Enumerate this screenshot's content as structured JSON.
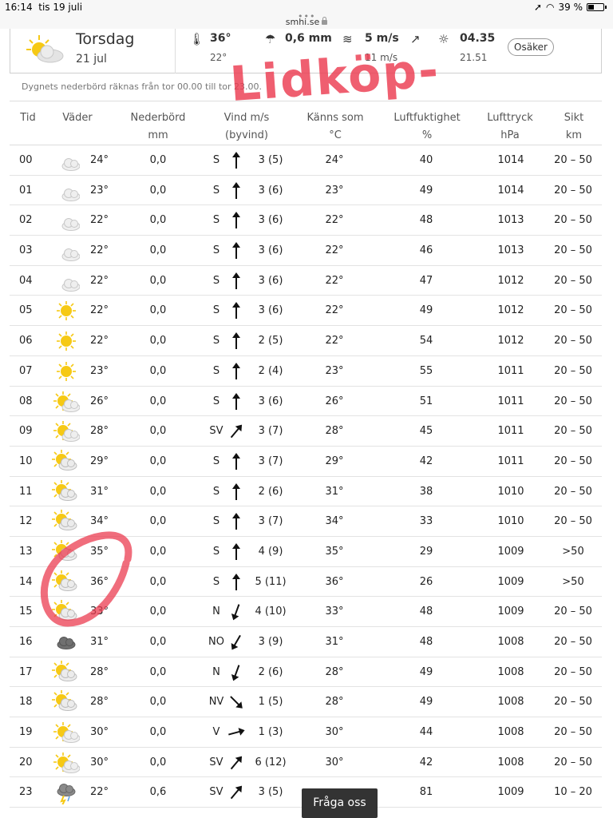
{
  "status": {
    "time": "16:14",
    "date": "tis 19 juli",
    "battery": "39 %"
  },
  "browser": {
    "url": "smhi.se"
  },
  "summary": {
    "day": "Torsdag",
    "date": "21 jul",
    "temp_max": "36°",
    "temp_min": "22°",
    "precip": "0,6 mm",
    "wind": "5 m/s",
    "gust": "11 m/s",
    "sunrise": "04.35",
    "sunset": "21.51",
    "uncertain_label": "Osäker"
  },
  "note": "Dygnets nederbörd räknas från tor 00.00 till tor 23.00.",
  "annotation": "Lidköp-",
  "colors": {
    "annotation": "#eb3c50",
    "sun": "#f6c915",
    "moon": "#f0c020",
    "cloud": "#dcdcdc",
    "dark_cloud": "#6e6e6e"
  },
  "table": {
    "headers": {
      "tid": "Tid",
      "vader": "Väder",
      "nederbord": "Nederbörd",
      "nederbord_unit": "mm",
      "vind": "Vind m/s",
      "vind_sub": "(byvind)",
      "kanns": "Känns som",
      "kanns_unit": "°C",
      "luft": "Luftfuktighet",
      "luft_unit": "%",
      "tryck": "Lufttryck",
      "tryck_unit": "hPa",
      "sikt": "Sikt",
      "sikt_unit": "km"
    },
    "rows": [
      {
        "tid": "00",
        "icon": "moon-cloud-icon",
        "temp": "24°",
        "rain": "0,0",
        "dir": "S",
        "wind": "3 (5)",
        "feel": "24°",
        "hum": "40",
        "press": "1014",
        "vis": "20 – 50"
      },
      {
        "tid": "01",
        "icon": "moon-cloud-icon",
        "temp": "23°",
        "rain": "0,0",
        "dir": "S",
        "wind": "3 (6)",
        "feel": "23°",
        "hum": "49",
        "press": "1014",
        "vis": "20 – 50"
      },
      {
        "tid": "02",
        "icon": "moon-cloud-icon",
        "temp": "22°",
        "rain": "0,0",
        "dir": "S",
        "wind": "3 (6)",
        "feel": "22°",
        "hum": "48",
        "press": "1013",
        "vis": "20 – 50"
      },
      {
        "tid": "03",
        "icon": "moon-cloud-icon",
        "temp": "22°",
        "rain": "0,0",
        "dir": "S",
        "wind": "3 (6)",
        "feel": "22°",
        "hum": "46",
        "press": "1013",
        "vis": "20 – 50"
      },
      {
        "tid": "04",
        "icon": "moon-cloud-icon",
        "temp": "22°",
        "rain": "0,0",
        "dir": "S",
        "wind": "3 (6)",
        "feel": "22°",
        "hum": "47",
        "press": "1012",
        "vis": "20 – 50"
      },
      {
        "tid": "05",
        "icon": "sun-icon",
        "temp": "22°",
        "rain": "0,0",
        "dir": "S",
        "wind": "3 (6)",
        "feel": "22°",
        "hum": "49",
        "press": "1012",
        "vis": "20 – 50"
      },
      {
        "tid": "06",
        "icon": "sun-icon",
        "temp": "22°",
        "rain": "0,0",
        "dir": "S",
        "wind": "2 (5)",
        "feel": "22°",
        "hum": "54",
        "press": "1012",
        "vis": "20 – 50"
      },
      {
        "tid": "07",
        "icon": "sun-icon",
        "temp": "23°",
        "rain": "0,0",
        "dir": "S",
        "wind": "2 (4)",
        "feel": "23°",
        "hum": "55",
        "press": "1011",
        "vis": "20 – 50"
      },
      {
        "tid": "08",
        "icon": "sun-cloud-icon",
        "temp": "26°",
        "rain": "0,0",
        "dir": "S",
        "wind": "3 (6)",
        "feel": "26°",
        "hum": "51",
        "press": "1011",
        "vis": "20 – 50"
      },
      {
        "tid": "09",
        "icon": "sun-cloud-icon",
        "temp": "28°",
        "rain": "0,0",
        "dir": "SV",
        "wind": "3 (7)",
        "feel": "28°",
        "hum": "45",
        "press": "1011",
        "vis": "20 – 50"
      },
      {
        "tid": "10",
        "icon": "cloud-sun-icon",
        "temp": "29°",
        "rain": "0,0",
        "dir": "S",
        "wind": "3 (7)",
        "feel": "29°",
        "hum": "42",
        "press": "1011",
        "vis": "20 – 50"
      },
      {
        "tid": "11",
        "icon": "cloud-sun-icon",
        "temp": "31°",
        "rain": "0,0",
        "dir": "S",
        "wind": "2 (6)",
        "feel": "31°",
        "hum": "38",
        "press": "1010",
        "vis": "20 – 50"
      },
      {
        "tid": "12",
        "icon": "cloud-sun-icon",
        "temp": "34°",
        "rain": "0,0",
        "dir": "S",
        "wind": "3 (7)",
        "feel": "34°",
        "hum": "33",
        "press": "1010",
        "vis": "20 – 50"
      },
      {
        "tid": "13",
        "icon": "cloud-sun-icon",
        "temp": "35°",
        "rain": "0,0",
        "dir": "S",
        "wind": "4 (9)",
        "feel": "35°",
        "hum": "29",
        "press": "1009",
        "vis": ">50"
      },
      {
        "tid": "14",
        "icon": "cloud-sun-icon",
        "temp": "36°",
        "rain": "0,0",
        "dir": "S",
        "wind": "5 (11)",
        "feel": "36°",
        "hum": "26",
        "press": "1009",
        "vis": ">50"
      },
      {
        "tid": "15",
        "icon": "cloud-sun-icon",
        "temp": "33°",
        "rain": "0,0",
        "dir": "N",
        "wind": "4 (10)",
        "feel": "33°",
        "hum": "48",
        "press": "1009",
        "vis": "20 – 50"
      },
      {
        "tid": "16",
        "icon": "dark-cloud-icon",
        "temp": "31°",
        "rain": "0,0",
        "dir": "NO",
        "wind": "3 (9)",
        "feel": "31°",
        "hum": "48",
        "press": "1008",
        "vis": "20 – 50"
      },
      {
        "tid": "17",
        "icon": "cloud-sun-icon",
        "temp": "28°",
        "rain": "0,0",
        "dir": "N",
        "wind": "2 (6)",
        "feel": "28°",
        "hum": "49",
        "press": "1008",
        "vis": "20 – 50"
      },
      {
        "tid": "18",
        "icon": "cloud-sun-icon",
        "temp": "28°",
        "rain": "0,0",
        "dir": "NV",
        "wind": "1 (5)",
        "feel": "28°",
        "hum": "49",
        "press": "1008",
        "vis": "20 – 50"
      },
      {
        "tid": "19",
        "icon": "sun-cloud-icon",
        "temp": "30°",
        "rain": "0,0",
        "dir": "V",
        "wind": "1 (3)",
        "feel": "30°",
        "hum": "44",
        "press": "1008",
        "vis": "20 – 50"
      },
      {
        "tid": "20",
        "icon": "sun-cloud-icon",
        "temp": "30°",
        "rain": "0,0",
        "dir": "SV",
        "wind": "6 (12)",
        "feel": "30°",
        "hum": "42",
        "press": "1008",
        "vis": "20 – 50"
      },
      {
        "tid": "23",
        "icon": "thunder-cloud-icon",
        "temp": "22°",
        "rain": "0,6",
        "dir": "SV",
        "wind": "3 (5)",
        "feel": "",
        "hum": "81",
        "press": "1009",
        "vis": "10 – 20"
      }
    ]
  },
  "ask_button": "Fråga oss"
}
